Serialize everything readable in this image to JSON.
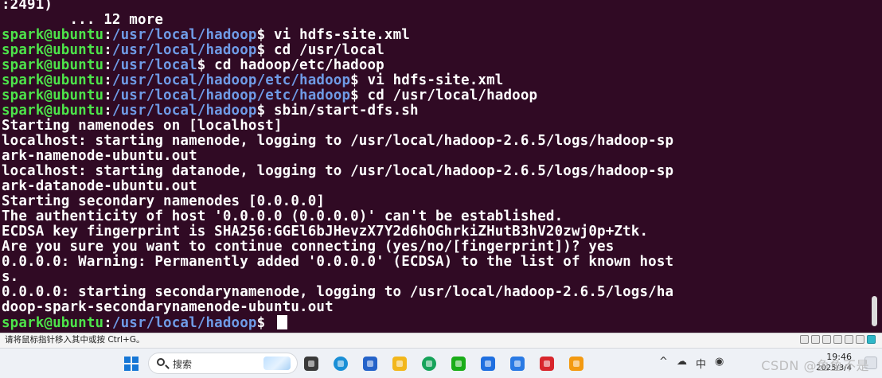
{
  "terminal": {
    "colors": {
      "background": "#300a24",
      "prompt_user": "#4de34a",
      "prompt_path": "#6f9be6",
      "text": "#ffffff"
    },
    "lines": [
      {
        "type": "output",
        "text": ":2491)"
      },
      {
        "type": "output",
        "text": "        ... 12 more"
      },
      {
        "type": "prompt",
        "user": "spark@ubuntu",
        "path": "/usr/local/hadoop",
        "cmd": " vi hdfs-site.xml"
      },
      {
        "type": "prompt",
        "user": "spark@ubuntu",
        "path": "/usr/local/hadoop",
        "cmd": " cd /usr/local"
      },
      {
        "type": "prompt",
        "user": "spark@ubuntu",
        "path": "/usr/local",
        "cmd": " cd hadoop/etc/hadoop"
      },
      {
        "type": "prompt",
        "user": "spark@ubuntu",
        "path": "/usr/local/hadoop/etc/hadoop",
        "cmd": " vi hdfs-site.xml"
      },
      {
        "type": "prompt",
        "user": "spark@ubuntu",
        "path": "/usr/local/hadoop/etc/hadoop",
        "cmd": " cd /usr/local/hadoop"
      },
      {
        "type": "prompt",
        "user": "spark@ubuntu",
        "path": "/usr/local/hadoop",
        "cmd": " sbin/start-dfs.sh"
      },
      {
        "type": "output",
        "text": "Starting namenodes on [localhost]"
      },
      {
        "type": "output",
        "text": "localhost: starting namenode, logging to /usr/local/hadoop-2.6.5/logs/hadoop-sp"
      },
      {
        "type": "output",
        "text": "ark-namenode-ubuntu.out"
      },
      {
        "type": "output",
        "text": "localhost: starting datanode, logging to /usr/local/hadoop-2.6.5/logs/hadoop-sp"
      },
      {
        "type": "output",
        "text": "ark-datanode-ubuntu.out"
      },
      {
        "type": "output",
        "text": "Starting secondary namenodes [0.0.0.0]"
      },
      {
        "type": "output",
        "text": "The authenticity of host '0.0.0.0 (0.0.0.0)' can't be established."
      },
      {
        "type": "output",
        "text": "ECDSA key fingerprint is SHA256:GGEl6bJHevzX7Y2d6hOGhrkiZHutB3hV20zwj0p+Ztk."
      },
      {
        "type": "output",
        "text": "Are you sure you want to continue connecting (yes/no/[fingerprint])? yes"
      },
      {
        "type": "output",
        "text": "0.0.0.0: Warning: Permanently added '0.0.0.0' (ECDSA) to the list of known host"
      },
      {
        "type": "output",
        "text": "s."
      },
      {
        "type": "output",
        "text": "0.0.0.0: starting secondarynamenode, logging to /usr/local/hadoop-2.6.5/logs/ha"
      },
      {
        "type": "output",
        "text": "doop-spark-secondarynamenode-ubuntu.out"
      },
      {
        "type": "prompt",
        "user": "spark@ubuntu",
        "path": "/usr/local/hadoop",
        "cmd": " ",
        "cursor": true
      }
    ]
  },
  "vm_status": {
    "hint": "请将鼠标指针移入其中或按 Ctrl+G。",
    "icons": [
      "network-icon",
      "sound-icon",
      "usb-icon",
      "display-icon",
      "printer-icon",
      "shared-folder-icon",
      "message-icon"
    ]
  },
  "taskbar": {
    "search_label": "搜索",
    "apps": [
      {
        "name": "task-view-icon",
        "color": "#3a3a3a"
      },
      {
        "name": "edge-icon",
        "color": "#1a8fd6"
      },
      {
        "name": "store-icon",
        "color": "#2563c9"
      },
      {
        "name": "file-explorer-icon",
        "color": "#f2b71c"
      },
      {
        "name": "edge-beta-icon",
        "color": "#16a35a"
      },
      {
        "name": "wechat-icon",
        "color": "#1aad19"
      },
      {
        "name": "thunder-icon",
        "color": "#1f6fe0"
      },
      {
        "name": "mail-icon",
        "color": "#2a7ae4"
      },
      {
        "name": "wps-icon",
        "color": "#d8262d"
      },
      {
        "name": "vmware-icon",
        "color": "#f39a12"
      }
    ],
    "clock_time": "19:46",
    "clock_date": "2025/3/4"
  },
  "watermark": "CSDN @鱼鱼不是"
}
